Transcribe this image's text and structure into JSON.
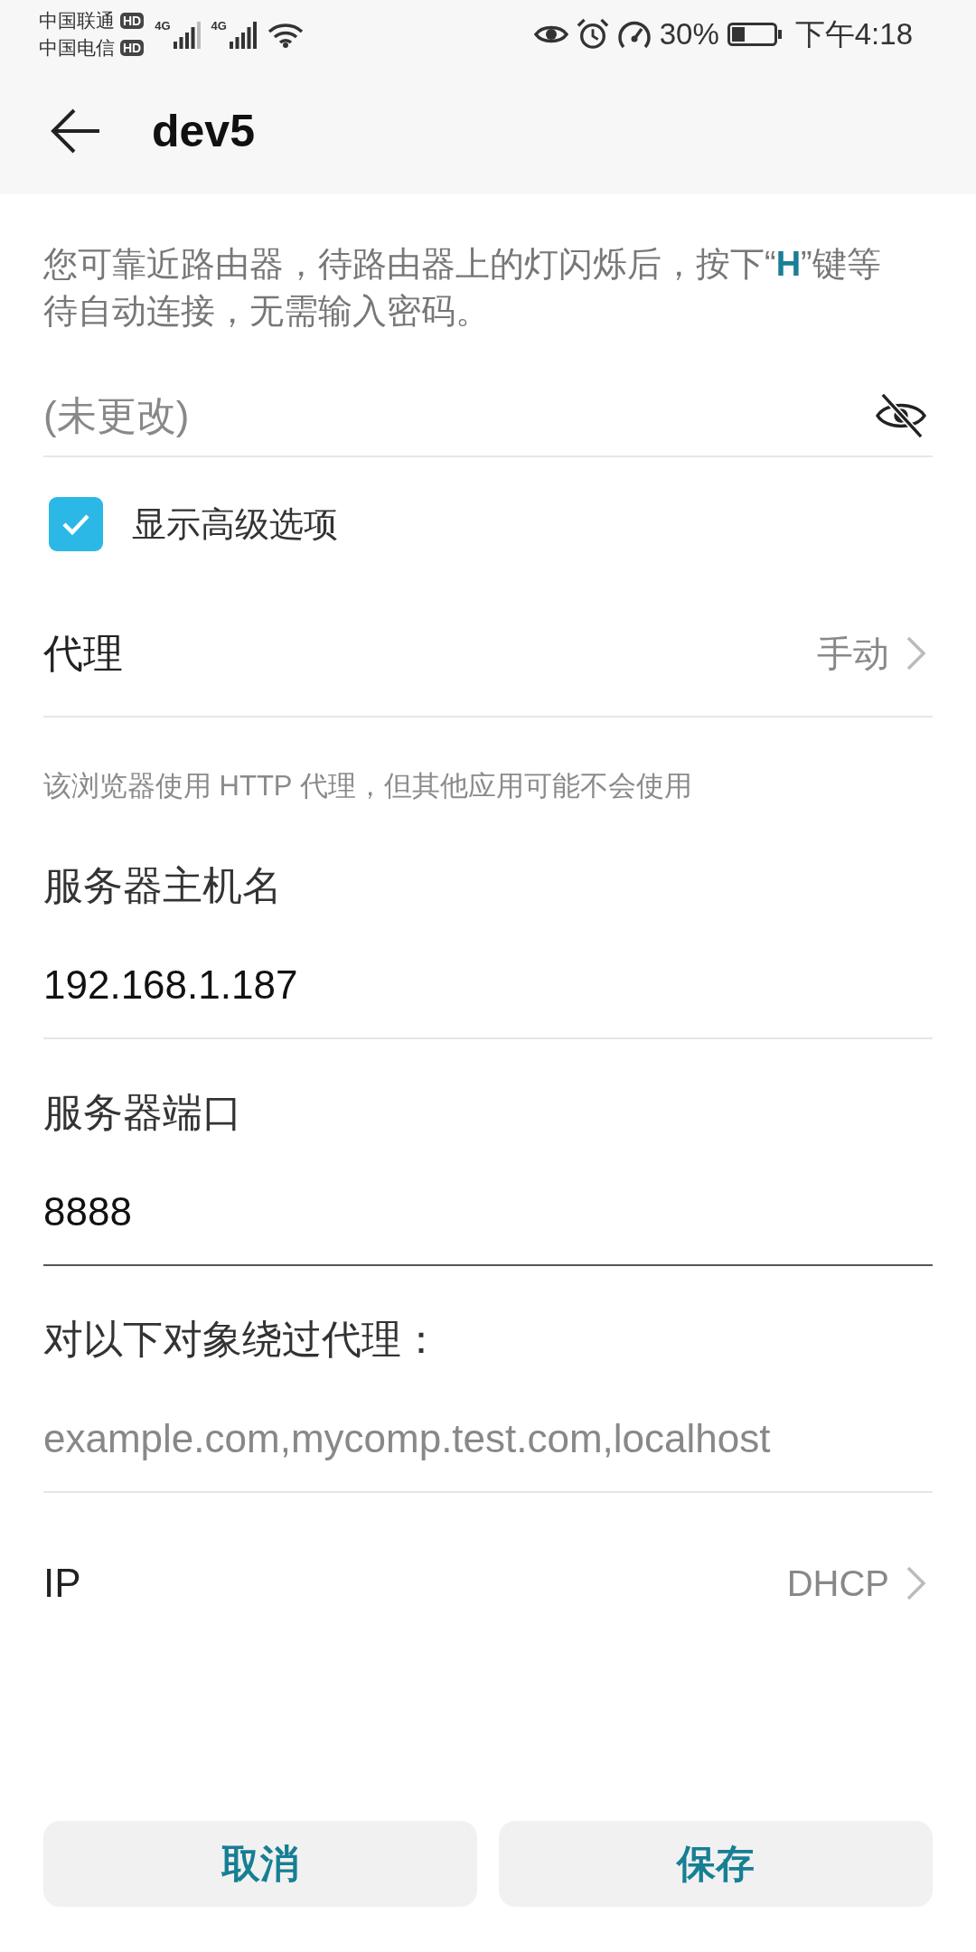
{
  "status_bar": {
    "carriers": [
      {
        "name": "中国联通",
        "badge": "HD"
      },
      {
        "name": "中国电信",
        "badge": "HD"
      }
    ],
    "signals": [
      {
        "network": "4G"
      },
      {
        "network": "4G"
      }
    ],
    "battery_percent": "30%",
    "time": "下午4:18"
  },
  "app_bar": {
    "title": "dev5"
  },
  "notice": "您可靠近路由器，待路由器上的灯闪烁后，按下“**H**”键等待自动连接，无需输入密码。",
  "password": {
    "placeholder": "(未更改)",
    "visible": false
  },
  "show_advanced": {
    "label": "显示高级选项",
    "checked": true
  },
  "proxy": {
    "label": "代理",
    "value": "手动"
  },
  "proxy_hint": "该浏览器使用 HTTP 代理，但其他应用可能不会使用",
  "fields": [
    {
      "label": "服务器主机名",
      "value": "192.168.1.187",
      "focused": false
    },
    {
      "label": "服务器端口",
      "value": "8888",
      "focused": true
    },
    {
      "label": "对以下对象绕过代理：",
      "placeholder": "example.com,mycomp.test.com,localhost",
      "focused": false
    }
  ],
  "ip": {
    "label": "IP",
    "value": "DHCP"
  },
  "buttons": [
    {
      "label": "取消"
    },
    {
      "label": "保存"
    }
  ]
}
